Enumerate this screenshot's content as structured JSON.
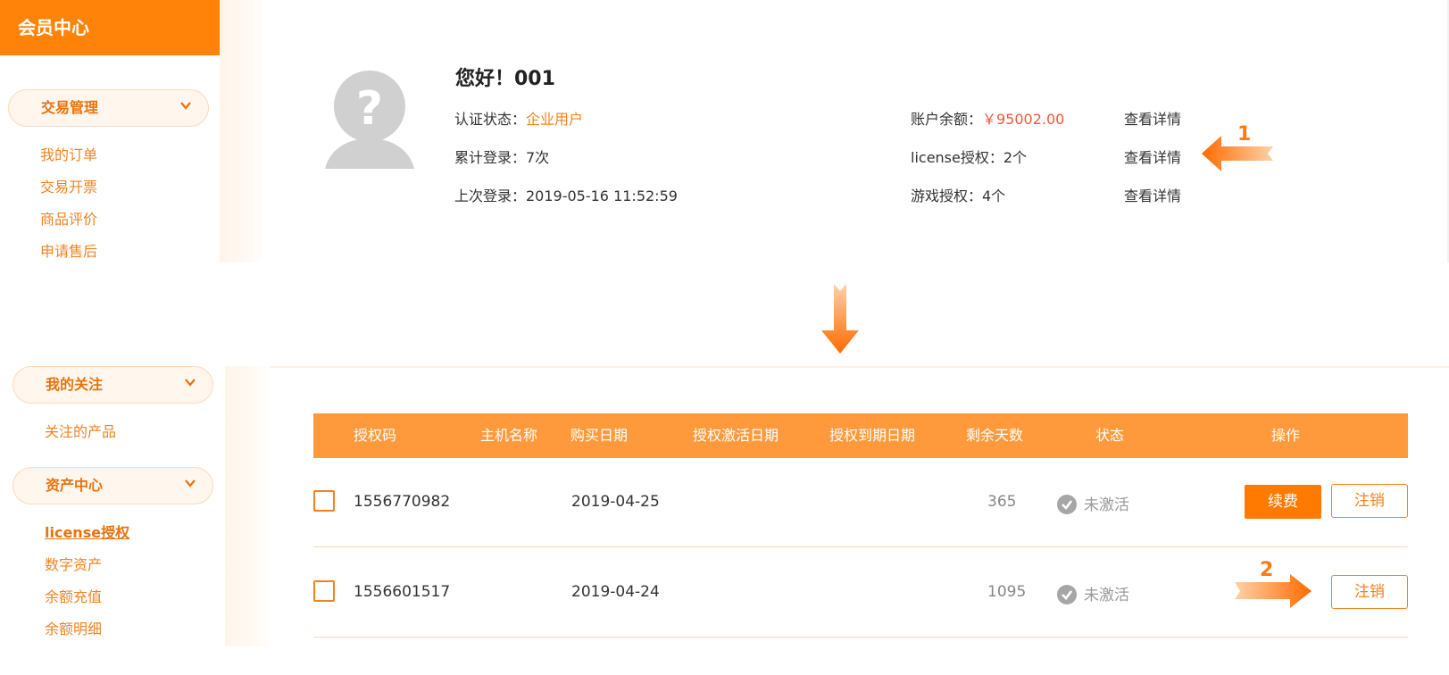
{
  "top": {
    "brand": "会员中心",
    "menu_group": "交易管理",
    "menu_items": [
      "我的订单",
      "交易开票",
      "商品评价",
      "申请售后"
    ],
    "greeting": "您好！001",
    "auth_status_label": "认证状态：",
    "auth_status_value": "企业用户",
    "login_count": "累计登录：7次",
    "last_login": "上次登录：2019-05-16 11:52:59",
    "balance_label": "账户余额：",
    "balance_value": "￥95002.00",
    "license_auth": "license授权：2个",
    "game_auth": "游戏授权：4个",
    "detail_links": [
      "查看详情",
      "查看详情",
      "查看详情"
    ],
    "callout_1": "1"
  },
  "bottom": {
    "menu_group_1": "我的关注",
    "menu_group_1_items": [
      "关注的产品"
    ],
    "menu_group_2": "资产中心",
    "menu_group_2_items": [
      "license授权",
      "数字资产",
      "余额充值",
      "余额明细"
    ],
    "table": {
      "headers": [
        "授权码",
        "主机名称",
        "购买日期",
        "授权激活日期",
        "授权到期日期",
        "剩余天数",
        "状态",
        "操作"
      ],
      "rows": [
        {
          "code": "1556770982",
          "host": "",
          "buy_date": "2019-04-25",
          "activate_date": "",
          "expire_date": "",
          "days_left": "365",
          "status": "未激活",
          "renew": "续费",
          "cancel": "注销"
        },
        {
          "code": "1556601517",
          "host": "",
          "buy_date": "2019-04-24",
          "activate_date": "",
          "expire_date": "",
          "days_left": "1095",
          "status": "未激活",
          "cancel": "注销"
        }
      ]
    },
    "callout_2": "2"
  },
  "colors": {
    "brand": "#ff8309",
    "accent": "#f5821f",
    "table_header": "#ff9a3c",
    "balance": "#f0573b",
    "status_icon": "#a6a6a6"
  },
  "icons": [
    "avatar-placeholder-icon",
    "chevron-down-icon",
    "check-circle-icon",
    "arrow-left-icon",
    "arrow-down-icon",
    "arrow-right-icon"
  ]
}
